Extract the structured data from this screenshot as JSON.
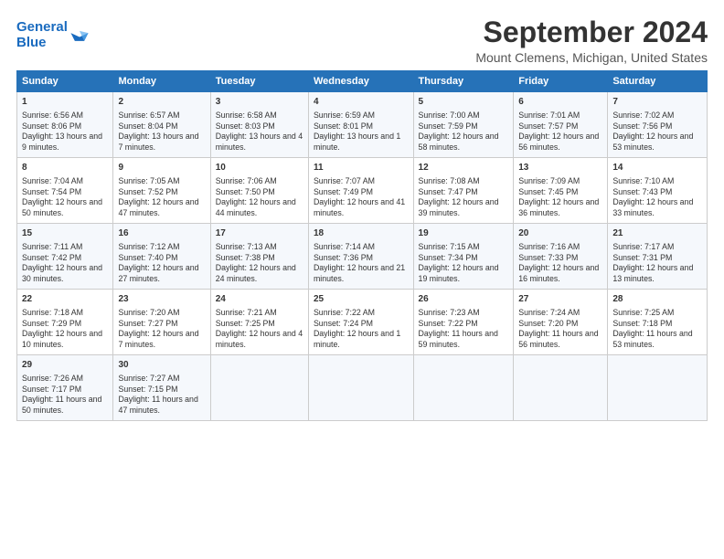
{
  "logo": {
    "line1": "General",
    "line2": "Blue"
  },
  "title": "September 2024",
  "subtitle": "Mount Clemens, Michigan, United States",
  "days_of_week": [
    "Sunday",
    "Monday",
    "Tuesday",
    "Wednesday",
    "Thursday",
    "Friday",
    "Saturday"
  ],
  "weeks": [
    [
      {
        "day": "1",
        "info": "Sunrise: 6:56 AM\nSunset: 8:06 PM\nDaylight: 13 hours and 9 minutes."
      },
      {
        "day": "2",
        "info": "Sunrise: 6:57 AM\nSunset: 8:04 PM\nDaylight: 13 hours and 7 minutes."
      },
      {
        "day": "3",
        "info": "Sunrise: 6:58 AM\nSunset: 8:03 PM\nDaylight: 13 hours and 4 minutes."
      },
      {
        "day": "4",
        "info": "Sunrise: 6:59 AM\nSunset: 8:01 PM\nDaylight: 13 hours and 1 minute."
      },
      {
        "day": "5",
        "info": "Sunrise: 7:00 AM\nSunset: 7:59 PM\nDaylight: 12 hours and 58 minutes."
      },
      {
        "day": "6",
        "info": "Sunrise: 7:01 AM\nSunset: 7:57 PM\nDaylight: 12 hours and 56 minutes."
      },
      {
        "day": "7",
        "info": "Sunrise: 7:02 AM\nSunset: 7:56 PM\nDaylight: 12 hours and 53 minutes."
      }
    ],
    [
      {
        "day": "8",
        "info": "Sunrise: 7:04 AM\nSunset: 7:54 PM\nDaylight: 12 hours and 50 minutes."
      },
      {
        "day": "9",
        "info": "Sunrise: 7:05 AM\nSunset: 7:52 PM\nDaylight: 12 hours and 47 minutes."
      },
      {
        "day": "10",
        "info": "Sunrise: 7:06 AM\nSunset: 7:50 PM\nDaylight: 12 hours and 44 minutes."
      },
      {
        "day": "11",
        "info": "Sunrise: 7:07 AM\nSunset: 7:49 PM\nDaylight: 12 hours and 41 minutes."
      },
      {
        "day": "12",
        "info": "Sunrise: 7:08 AM\nSunset: 7:47 PM\nDaylight: 12 hours and 39 minutes."
      },
      {
        "day": "13",
        "info": "Sunrise: 7:09 AM\nSunset: 7:45 PM\nDaylight: 12 hours and 36 minutes."
      },
      {
        "day": "14",
        "info": "Sunrise: 7:10 AM\nSunset: 7:43 PM\nDaylight: 12 hours and 33 minutes."
      }
    ],
    [
      {
        "day": "15",
        "info": "Sunrise: 7:11 AM\nSunset: 7:42 PM\nDaylight: 12 hours and 30 minutes."
      },
      {
        "day": "16",
        "info": "Sunrise: 7:12 AM\nSunset: 7:40 PM\nDaylight: 12 hours and 27 minutes."
      },
      {
        "day": "17",
        "info": "Sunrise: 7:13 AM\nSunset: 7:38 PM\nDaylight: 12 hours and 24 minutes."
      },
      {
        "day": "18",
        "info": "Sunrise: 7:14 AM\nSunset: 7:36 PM\nDaylight: 12 hours and 21 minutes."
      },
      {
        "day": "19",
        "info": "Sunrise: 7:15 AM\nSunset: 7:34 PM\nDaylight: 12 hours and 19 minutes."
      },
      {
        "day": "20",
        "info": "Sunrise: 7:16 AM\nSunset: 7:33 PM\nDaylight: 12 hours and 16 minutes."
      },
      {
        "day": "21",
        "info": "Sunrise: 7:17 AM\nSunset: 7:31 PM\nDaylight: 12 hours and 13 minutes."
      }
    ],
    [
      {
        "day": "22",
        "info": "Sunrise: 7:18 AM\nSunset: 7:29 PM\nDaylight: 12 hours and 10 minutes."
      },
      {
        "day": "23",
        "info": "Sunrise: 7:20 AM\nSunset: 7:27 PM\nDaylight: 12 hours and 7 minutes."
      },
      {
        "day": "24",
        "info": "Sunrise: 7:21 AM\nSunset: 7:25 PM\nDaylight: 12 hours and 4 minutes."
      },
      {
        "day": "25",
        "info": "Sunrise: 7:22 AM\nSunset: 7:24 PM\nDaylight: 12 hours and 1 minute."
      },
      {
        "day": "26",
        "info": "Sunrise: 7:23 AM\nSunset: 7:22 PM\nDaylight: 11 hours and 59 minutes."
      },
      {
        "day": "27",
        "info": "Sunrise: 7:24 AM\nSunset: 7:20 PM\nDaylight: 11 hours and 56 minutes."
      },
      {
        "day": "28",
        "info": "Sunrise: 7:25 AM\nSunset: 7:18 PM\nDaylight: 11 hours and 53 minutes."
      }
    ],
    [
      {
        "day": "29",
        "info": "Sunrise: 7:26 AM\nSunset: 7:17 PM\nDaylight: 11 hours and 50 minutes."
      },
      {
        "day": "30",
        "info": "Sunrise: 7:27 AM\nSunset: 7:15 PM\nDaylight: 11 hours and 47 minutes."
      },
      {
        "day": "",
        "info": ""
      },
      {
        "day": "",
        "info": ""
      },
      {
        "day": "",
        "info": ""
      },
      {
        "day": "",
        "info": ""
      },
      {
        "day": "",
        "info": ""
      }
    ]
  ]
}
